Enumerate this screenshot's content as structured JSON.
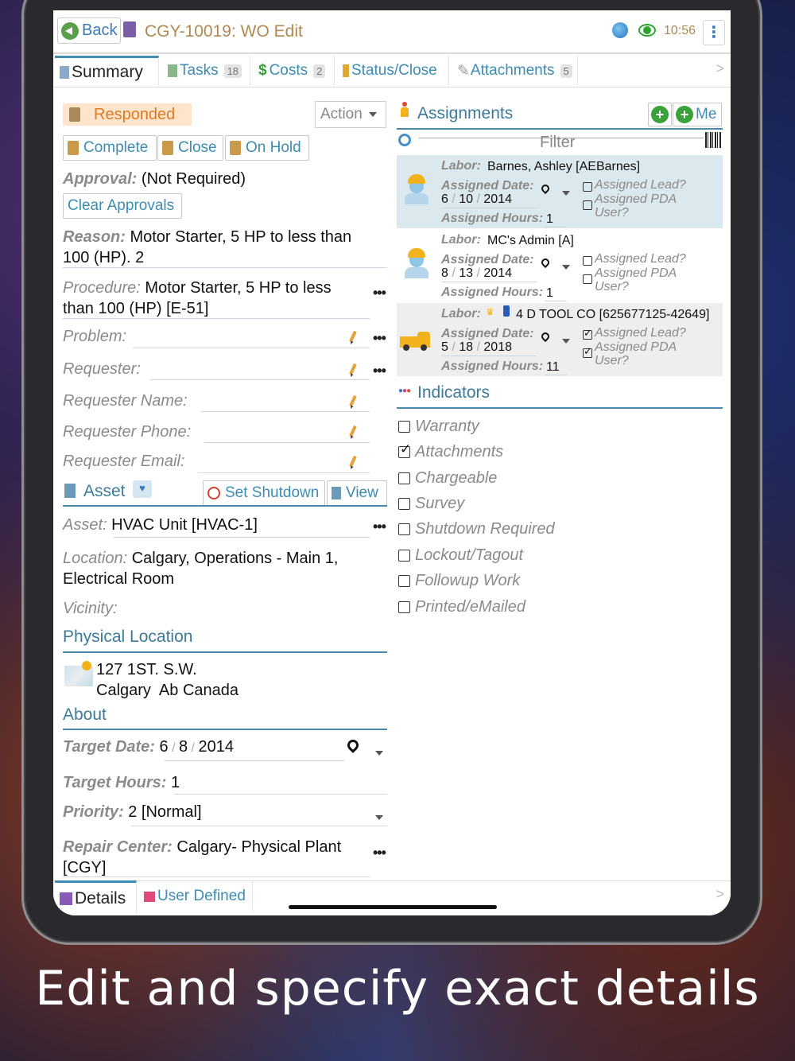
{
  "header": {
    "back_label": "Back",
    "title": "CGY-10019: WO Edit",
    "time": "10:56"
  },
  "tabs": [
    {
      "label": "Summary"
    },
    {
      "label": "Tasks",
      "badge": "18"
    },
    {
      "label": "Costs",
      "badge": "2"
    },
    {
      "label": "Status/Close"
    },
    {
      "label": "Attachments",
      "badge": "5"
    }
  ],
  "summary": {
    "status": "Responded",
    "action_label": "Action",
    "buttons": {
      "complete": "Complete",
      "close": "Close",
      "on_hold": "On Hold"
    },
    "approval_label": "Approval:",
    "approval_value": "(Not Required)",
    "clear_approvals": "Clear Approvals",
    "reason_label": "Reason:",
    "reason_line1": "Motor Starter, 5 HP to less than",
    "reason_line2": "100 (HP). 2",
    "procedure_label": "Procedure:",
    "procedure_line1": "Motor Starter, 5 HP to less",
    "procedure_line2": "than 100 (HP) [E-51]",
    "problem_label": "Problem:",
    "requester_label": "Requester:",
    "requester_name_label": "Requester Name:",
    "requester_phone_label": "Requester Phone:",
    "requester_email_label": "Requester Email:"
  },
  "asset": {
    "header": "Asset",
    "set_shutdown": "Set Shutdown",
    "view": "View",
    "asset_label": "Asset:",
    "asset_value": "HVAC Unit [HVAC-1]",
    "location_label": "Location:",
    "location_line1": "Calgary, Operations - Main 1,",
    "location_line2": "Electrical Room",
    "vicinity_label": "Vicinity:"
  },
  "physical_location": {
    "header": "Physical Location",
    "line1": "127 1ST. S.W.",
    "line2": "Calgary  Ab Canada"
  },
  "about": {
    "header": "About",
    "target_date_label": "Target Date:",
    "target_date": {
      "m": "6",
      "d": "8",
      "y": "2014"
    },
    "target_hours_label": "Target Hours:",
    "target_hours": "1",
    "priority_label": "Priority:",
    "priority_value": "2 [Normal]",
    "repair_center_label": "Repair Center:",
    "repair_center_line1": "Calgary- Physical Plant",
    "repair_center_line2": "[CGY]"
  },
  "assignments": {
    "header": "Assignments",
    "me_label": "Me",
    "filter_placeholder": "Filter",
    "labor_label": "Labor:",
    "date_label": "Assigned Date:",
    "hours_label": "Assigned Hours:",
    "lead_label": "Assigned Lead?",
    "pda_label1": "Assigned PDA",
    "pda_label2": "User?",
    "items": [
      {
        "labor": "Barnes, Ashley [AEBarnes]",
        "m": "6",
        "d": "10",
        "y": "2014",
        "hours": "1",
        "lead": false,
        "pda": false
      },
      {
        "labor": "MC's Admin [A]",
        "m": "8",
        "d": "13",
        "y": "2014",
        "hours": "1",
        "lead": false,
        "pda": false
      },
      {
        "labor": "4 D TOOL CO [625677125-42649]",
        "m": "5",
        "d": "18",
        "y": "2018",
        "hours": "11",
        "lead": true,
        "pda": true
      }
    ]
  },
  "indicators": {
    "header": "Indicators",
    "items": [
      {
        "label": "Warranty",
        "checked": false
      },
      {
        "label": "Attachments",
        "checked": true
      },
      {
        "label": "Chargeable",
        "checked": false
      },
      {
        "label": "Survey",
        "checked": false
      },
      {
        "label": "Shutdown Required",
        "checked": false
      },
      {
        "label": "Lockout/Tagout",
        "checked": false
      },
      {
        "label": "Followup Work",
        "checked": false
      },
      {
        "label": "Printed/eMailed",
        "checked": false
      }
    ]
  },
  "bottom_tabs": [
    {
      "label": "Details"
    },
    {
      "label": "User Defined"
    }
  ],
  "caption": "Edit and specify exact details",
  "colors": {
    "accent": "#3d8cb4",
    "status_bg": "#fde4cc",
    "status_fg": "#e07a20",
    "selected_row": "#dbe8ee"
  }
}
